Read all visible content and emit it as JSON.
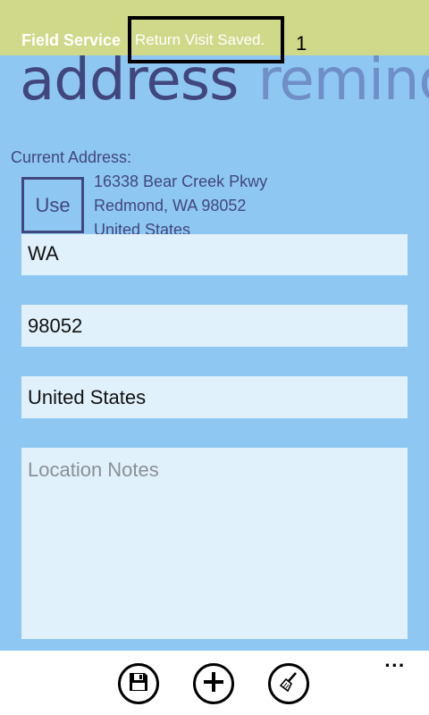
{
  "toast": {
    "app_name": "Field Service",
    "message": "Return Visit Saved.",
    "annotation": "1"
  },
  "pivot": {
    "current": "address",
    "next": "remind"
  },
  "current_address": {
    "label": "Current Address:",
    "use_label": "Use",
    "line1": "16338 Bear Creek Pkwy",
    "line2": "Redmond, WA 98052",
    "line3": "United States"
  },
  "form": {
    "state_value": "WA",
    "zip_value": "98052",
    "country_value": "United States",
    "notes_placeholder": "Location Notes"
  },
  "appbar": {
    "buttons": [
      {
        "icon": "save-icon"
      },
      {
        "icon": "add-icon"
      },
      {
        "icon": "clear-icon"
      }
    ],
    "more_label": "..."
  },
  "colors": {
    "background": "#8ec8f2",
    "toast": "#d0d98a",
    "accent": "#41477e",
    "field": "#e0f1fb"
  }
}
